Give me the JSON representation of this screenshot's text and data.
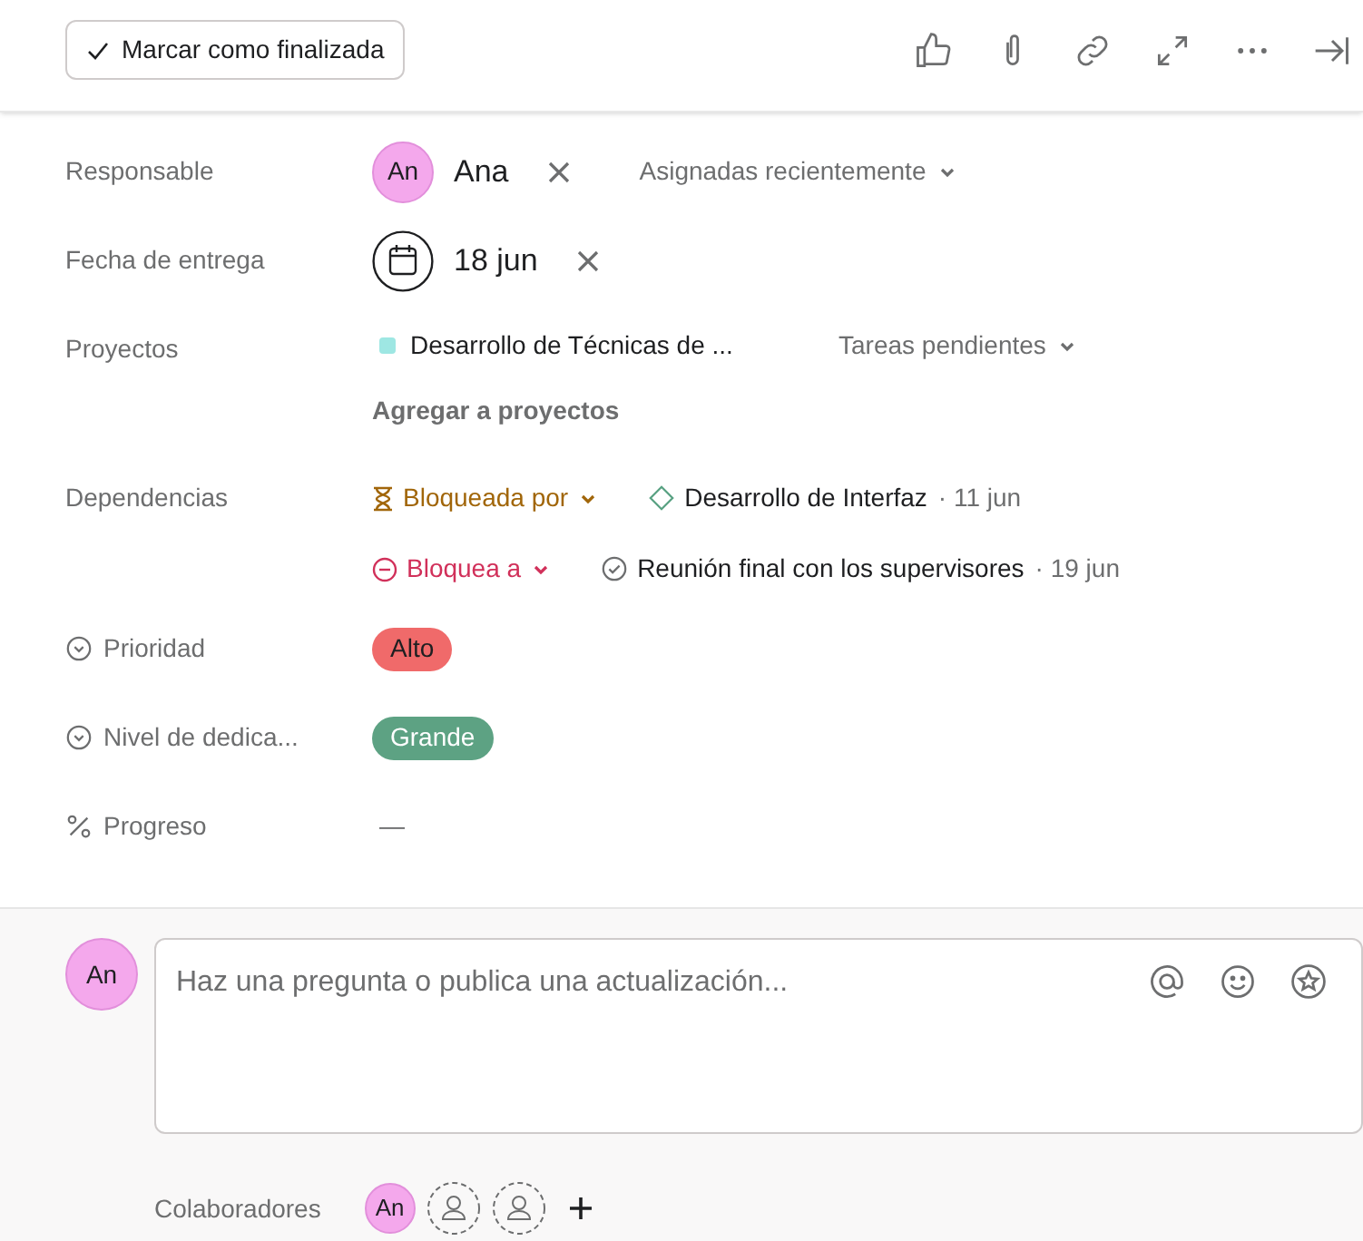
{
  "complete_button": {
    "label": "Marcar como finalizada"
  },
  "fields": [
    {
      "kind": "assignee",
      "label": "Responsable",
      "initials": "An",
      "name": "Ana",
      "dropdown": "Asignadas recientemente"
    },
    {
      "kind": "date",
      "label": "Fecha de entrega",
      "value": "18 jun"
    },
    {
      "kind": "projects",
      "label": "Proyectos",
      "projects": [
        {
          "name": "Desarrollo de Técnicas de ...",
          "color": "#9ee7e3",
          "section": "Tareas pendientes"
        }
      ],
      "add_label": "Agregar a proyectos"
    },
    {
      "kind": "dependencies",
      "label": "Dependencias",
      "groups": [
        {
          "kind": "blocked_by",
          "label": "Bloqueada por",
          "task": {
            "kind": "milestone",
            "name": "Desarrollo de Interfaz"
          },
          "date": "· 11 jun"
        },
        {
          "kind": "blocking",
          "label": "Bloquea a",
          "task": {
            "kind": "task",
            "name": "Reunión final con los supervisores"
          },
          "date": "· 19 jun"
        }
      ]
    },
    {
      "kind": "enum",
      "label": "Prioridad",
      "value": "Alto",
      "color": "#f06a6a"
    },
    {
      "kind": "enum",
      "label": "Nivel de dedica...",
      "value": "Grande",
      "color": "#5da283"
    },
    {
      "kind": "progress",
      "label": "Progreso",
      "value": "—"
    }
  ],
  "comment": {
    "initials": "An",
    "placeholder": "Haz una pregunta o publica una actualización..."
  },
  "collaborators": {
    "label": "Colaboradores",
    "members": [
      {
        "kind": "avatar",
        "initials": "An"
      },
      {
        "kind": "empty"
      },
      {
        "kind": "empty"
      }
    ]
  }
}
